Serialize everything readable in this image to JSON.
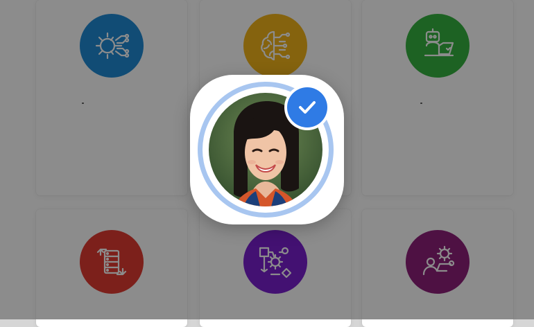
{
  "page": {
    "background": "#ffffff",
    "overlay_color": "rgba(0,0,0,0.45)"
  },
  "cards": [
    {
      "icon": "gear-circuit-icon",
      "color": "#1f8bd6"
    },
    {
      "icon": "brain-circuit-icon",
      "color": "#f2b51a"
    },
    {
      "icon": "robot-laptop-icon",
      "color": "#36b340"
    },
    {
      "icon": "server-sync-icon",
      "color": "#e23b32"
    },
    {
      "icon": "workflow-gear-icon",
      "color": "#7a1fd0"
    },
    {
      "icon": "person-gear-icon",
      "color": "#8f1f7a"
    }
  ],
  "profile": {
    "avatar_icon": "profile-photo",
    "ring_color": "#a8c6f0",
    "verified_icon": "checkmark-icon",
    "verified_color": "#2f7be5"
  }
}
